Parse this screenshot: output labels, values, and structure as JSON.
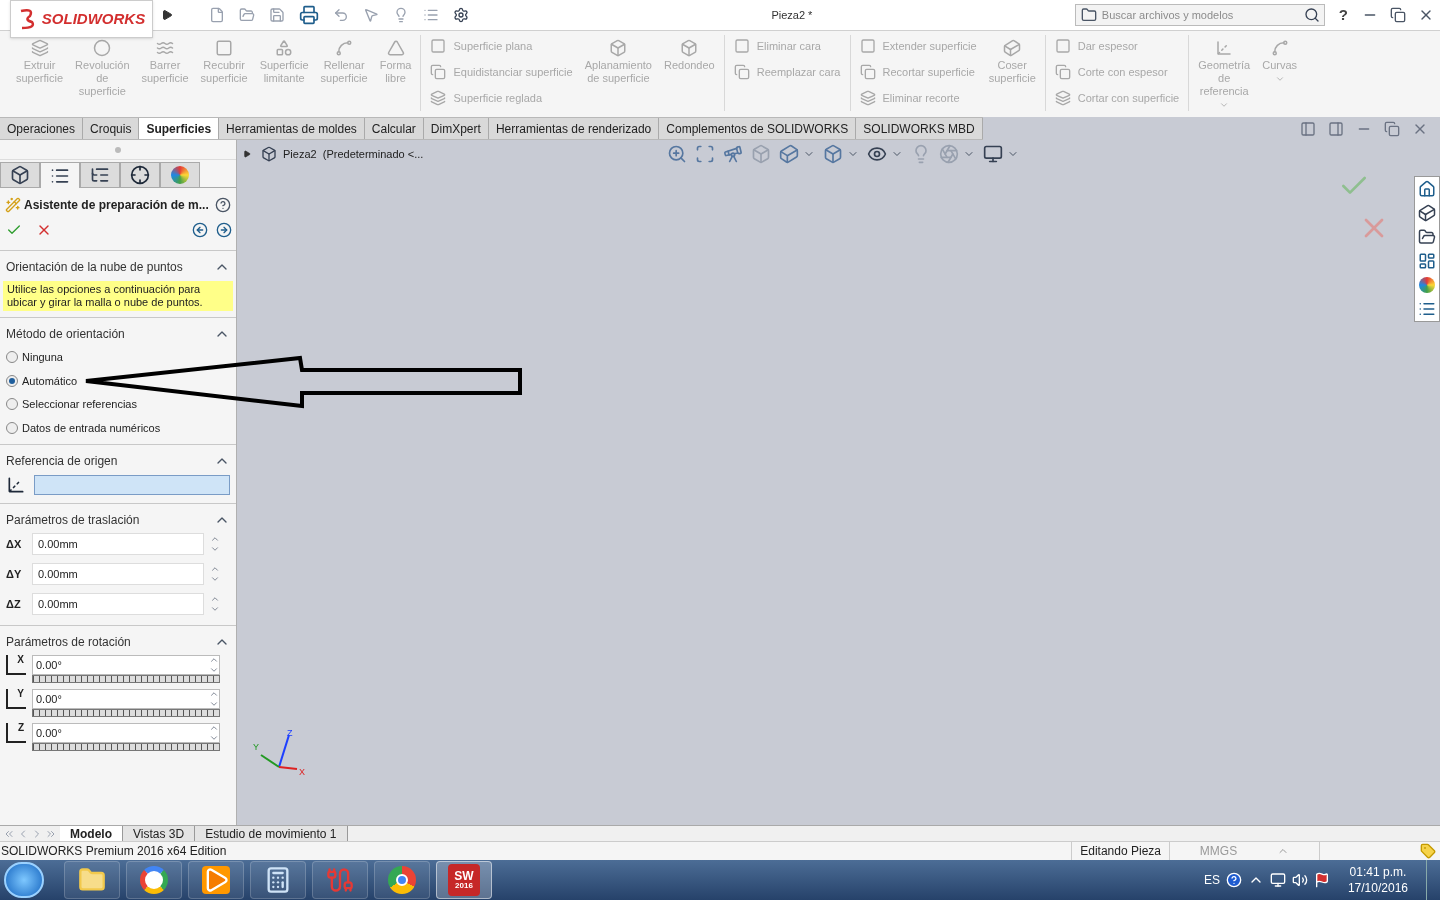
{
  "app_bar": {
    "logo": "SOLIDWORKS",
    "document_title": "Pieza2 *",
    "search": {
      "placeholder": "Buscar archivos y modelos"
    },
    "help": "?"
  },
  "ribbon": [
    {
      "kind": "large",
      "label_lines": [
        "Extruir",
        "superficie"
      ],
      "disabled": true,
      "dropdown": false
    },
    {
      "kind": "large",
      "label_lines": [
        "Revolución",
        "de",
        "superficie"
      ],
      "disabled": true,
      "dropdown": false
    },
    {
      "kind": "large",
      "label_lines": [
        "Barrer",
        "superficie"
      ],
      "disabled": true,
      "dropdown": false
    },
    {
      "kind": "large",
      "label_lines": [
        "Recubrir",
        "superficie"
      ],
      "disabled": true,
      "dropdown": false
    },
    {
      "kind": "large",
      "label_lines": [
        "Superficie",
        "limitante"
      ],
      "disabled": true,
      "dropdown": false
    },
    {
      "kind": "large",
      "label_lines": [
        "Rellenar",
        "superficie"
      ],
      "disabled": true,
      "dropdown": false
    },
    {
      "kind": "large",
      "label_lines": [
        "Forma",
        "libre"
      ],
      "disabled": true,
      "dropdown": false
    },
    {
      "kind": "separator"
    },
    {
      "kind": "stack",
      "items": [
        {
          "label": "Superficie plana",
          "disabled": true
        },
        {
          "label": "Equidistanciar superficie",
          "disabled": true
        },
        {
          "label": "Superficie reglada",
          "disabled": true
        }
      ]
    },
    {
      "kind": "large",
      "label_lines": [
        "Aplanamiento",
        "de superficie"
      ],
      "disabled": true,
      "dropdown": false
    },
    {
      "kind": "large",
      "label_lines": [
        "Redondeo"
      ],
      "disabled": true,
      "dropdown": false
    },
    {
      "kind": "separator"
    },
    {
      "kind": "stack",
      "items": [
        {
          "label": "Eliminar cara",
          "disabled": true
        },
        {
          "label": "Reemplazar cara",
          "disabled": true
        }
      ]
    },
    {
      "kind": "separator"
    },
    {
      "kind": "stack",
      "items": [
        {
          "label": "Extender superficie",
          "disabled": true
        },
        {
          "label": "Recortar superficie",
          "disabled": true
        },
        {
          "label": "Eliminar recorte",
          "disabled": true
        }
      ]
    },
    {
      "kind": "large",
      "label_lines": [
        "Coser",
        "superficie"
      ],
      "disabled": true,
      "dropdown": false
    },
    {
      "kind": "separator"
    },
    {
      "kind": "stack",
      "items": [
        {
          "label": "Dar espesor",
          "disabled": true
        },
        {
          "label": "Corte con espesor",
          "disabled": true
        },
        {
          "label": "Cortar con superficie",
          "disabled": true
        }
      ]
    },
    {
      "kind": "separator"
    },
    {
      "kind": "large",
      "label_lines": [
        "Geometría",
        "de",
        "referencia"
      ],
      "disabled": true,
      "dropdown": true
    },
    {
      "kind": "large",
      "label_lines": [
        "Curvas"
      ],
      "disabled": true,
      "dropdown": true
    }
  ],
  "command_tabs": [
    {
      "label": "Operaciones",
      "selected": false
    },
    {
      "label": "Croquis",
      "selected": false
    },
    {
      "label": "Superficies",
      "selected": true
    },
    {
      "label": "Herramientas de moldes",
      "selected": false
    },
    {
      "label": "Calcular",
      "selected": false
    },
    {
      "label": "DimXpert",
      "selected": false
    },
    {
      "label": "Herramientas de renderizado",
      "selected": false
    },
    {
      "label": "Complementos de SOLIDWORKS",
      "selected": false
    },
    {
      "label": "SOLIDWORKS MBD",
      "selected": false
    }
  ],
  "panel_tabs": [
    {
      "kind": "feature-tree",
      "selected": false
    },
    {
      "kind": "property",
      "selected": true
    },
    {
      "kind": "configuration",
      "selected": false
    },
    {
      "kind": "dimxpert",
      "selected": false
    },
    {
      "kind": "display",
      "selected": false
    }
  ],
  "property_manager": {
    "title": "Asistente de preparación de m...",
    "sections": [
      {
        "kind": "message",
        "title": "Orientación de la nube de puntos",
        "expanded": true,
        "message": "Utilice las opciones a continuación para ubicar y girar la malla o nube de puntos."
      },
      {
        "kind": "radio",
        "title": "Método de orientación",
        "expanded": true,
        "options": [
          {
            "label": "Ninguna",
            "selected": false
          },
          {
            "label": "Automático",
            "selected": true
          },
          {
            "label": "Seleccionar referencias",
            "selected": false
          },
          {
            "label": "Datos de entrada numéricos",
            "selected": false
          }
        ]
      },
      {
        "kind": "selection",
        "title": "Referencia de origen",
        "expanded": true
      },
      {
        "kind": "translation",
        "title": "Parámetros de traslación",
        "expanded": true,
        "fields": [
          {
            "label": "ΔX",
            "value": "0.00mm"
          },
          {
            "label": "ΔY",
            "value": "0.00mm"
          },
          {
            "label": "ΔZ",
            "value": "0.00mm"
          }
        ]
      },
      {
        "kind": "rotation",
        "title": "Parámetros de rotación",
        "expanded": true,
        "fields": [
          {
            "axis": "X",
            "value": "0.00°"
          },
          {
            "axis": "Y",
            "value": "0.00°"
          },
          {
            "axis": "Z",
            "value": "0.00°"
          }
        ]
      }
    ]
  },
  "viewport": {
    "tree_item": "Pieza2  (Predeterminado <...",
    "triad_axes": [
      "X",
      "Y",
      "Z"
    ]
  },
  "bottom_tabs": [
    {
      "label": "Modelo",
      "selected": true
    },
    {
      "label": "Vistas 3D",
      "selected": false
    },
    {
      "label": "Estudio de movimiento 1",
      "selected": false
    }
  ],
  "status_bar": {
    "edition": "SOLIDWORKS Premium 2016 x64 Edition",
    "mode": "Editando Pieza",
    "units": "MMGS"
  },
  "taskbar": {
    "apps": [
      {
        "kind": "explorer",
        "active": false
      },
      {
        "kind": "browser-g",
        "active": false
      },
      {
        "kind": "media",
        "active": false
      },
      {
        "kind": "calculator",
        "active": false
      },
      {
        "kind": "ribbon-app",
        "active": false
      },
      {
        "kind": "chrome",
        "active": false
      },
      {
        "kind": "cad",
        "active": true,
        "badge": "SW",
        "version": "2016"
      }
    ],
    "language": "ES",
    "time": "01:41 p.m.",
    "date": "17/10/2016"
  }
}
